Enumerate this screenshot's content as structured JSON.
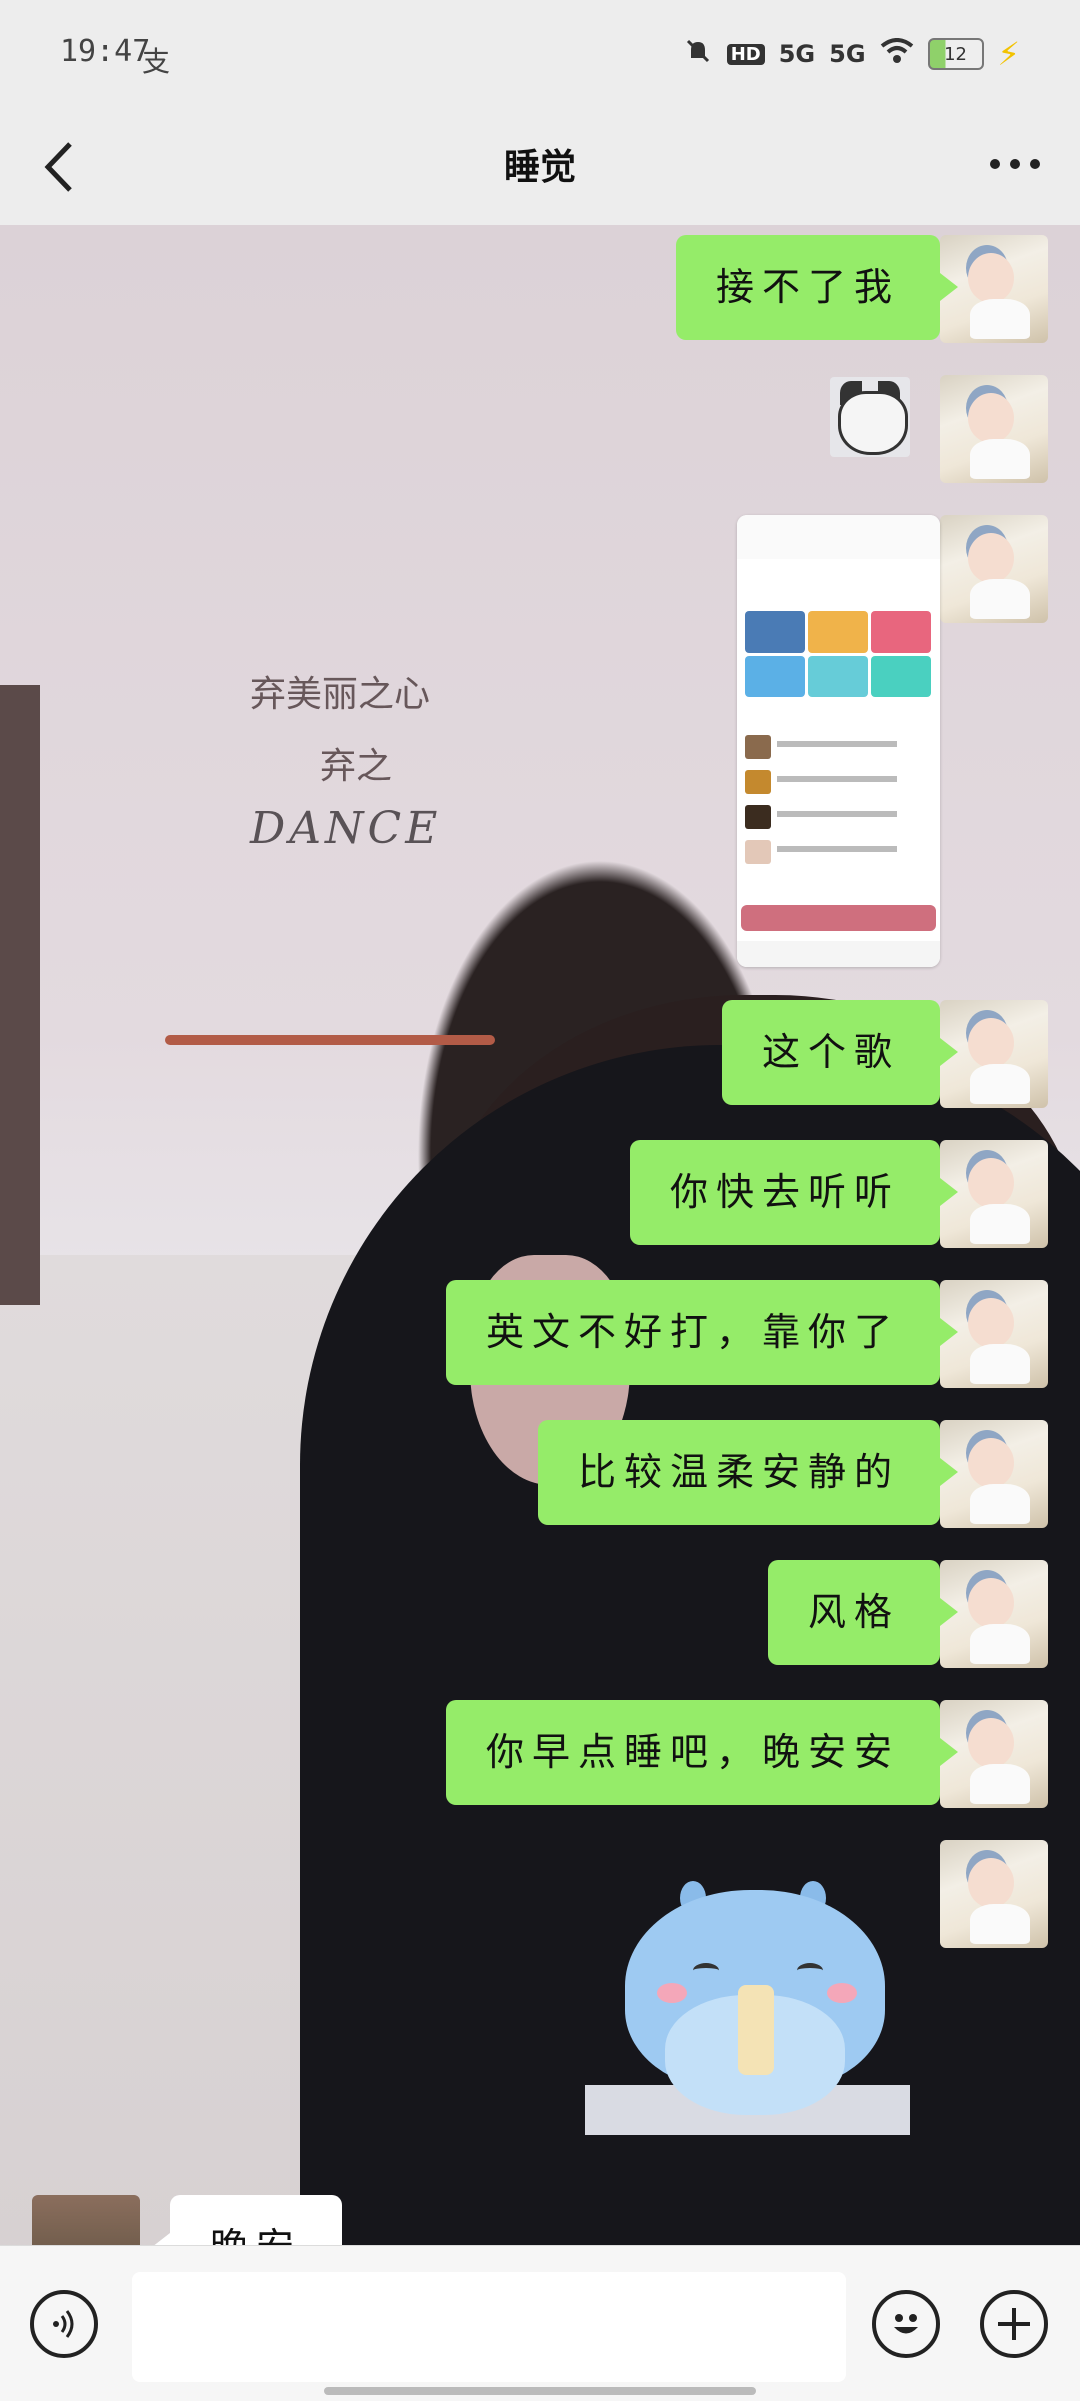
{
  "status_bar": {
    "time": "19:47",
    "carrier_glyph": "支",
    "icons": [
      "bell-muted-icon",
      "hd-icon",
      "5g-signal-icon",
      "5g-signal-icon",
      "wifi-icon",
      "battery-icon",
      "charging-icon"
    ],
    "hd_label": "HD",
    "net1": "5G",
    "net2": "5G",
    "battery_level": "12"
  },
  "header": {
    "title": "睡觉",
    "back_icon": "chevron-left-icon",
    "more_icon": "more-horizontal-icon"
  },
  "wall_decor": {
    "line1": "弃美丽之心",
    "line2": "弃之",
    "line3": "DANCE"
  },
  "messages": [
    {
      "id": "m1",
      "type": "text",
      "text": "接不了我"
    },
    {
      "id": "m2",
      "type": "sticker",
      "description": "cat-sticker-icon"
    },
    {
      "id": "m3",
      "type": "image",
      "description": "music-app-screenshot"
    },
    {
      "id": "m4",
      "type": "text",
      "text": "这个歌"
    },
    {
      "id": "m5",
      "type": "text",
      "text": "你快去听听"
    },
    {
      "id": "m6",
      "type": "text",
      "text": "英文不好打，靠你了"
    },
    {
      "id": "m7",
      "type": "text",
      "text": "比较温柔安静的"
    },
    {
      "id": "m8",
      "type": "text",
      "text": "风格"
    },
    {
      "id": "m9",
      "type": "text",
      "text": "你早点睡吧，晚安安"
    },
    {
      "id": "m10",
      "type": "sticker",
      "description": "blue-dinosaur-sticker-icon"
    }
  ],
  "incoming": {
    "text": "晚安"
  },
  "input_bar": {
    "voice_icon": "voice-icon",
    "emoji_icon": "emoji-icon",
    "plus_icon": "plus-icon",
    "text_value": ""
  },
  "colors": {
    "outgoing_bubble": "#95ec69",
    "incoming_bubble": "#ffffff",
    "chrome": "#ededed"
  }
}
